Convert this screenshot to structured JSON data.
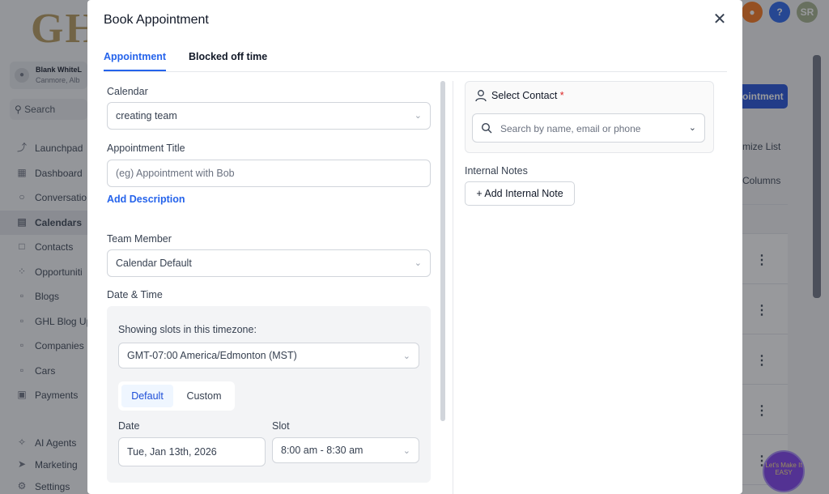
{
  "background": {
    "logo": "GH",
    "account": {
      "name": "Blank WhiteL",
      "location": "Canmore, Alb"
    },
    "search_label": "Search",
    "nav": [
      {
        "label": "Launchpad",
        "icon": "rocket-icon"
      },
      {
        "label": "Dashboard",
        "icon": "grid-icon"
      },
      {
        "label": "Conversatio",
        "icon": "chat-icon"
      },
      {
        "label": "Calendars",
        "icon": "calendar-icon",
        "active": true
      },
      {
        "label": "Contacts",
        "icon": "contacts-icon"
      },
      {
        "label": "Opportuniti",
        "icon": "opportunities-icon"
      },
      {
        "label": "Blogs",
        "icon": "blog-icon"
      },
      {
        "label": "GHL Blog Up",
        "icon": "blog-icon"
      },
      {
        "label": "Companies",
        "icon": "building-icon"
      },
      {
        "label": "Cars",
        "icon": "car-icon"
      },
      {
        "label": "Payments",
        "icon": "payments-icon"
      }
    ],
    "nav_bottom": [
      {
        "label": "AI Agents",
        "icon": "sparkle-icon"
      },
      {
        "label": "Marketing",
        "icon": "send-icon"
      },
      {
        "label": "Settings",
        "icon": "gear-icon"
      }
    ],
    "top_right": {
      "help": "?",
      "user_initials": "SR"
    },
    "new_appointment_label": "ointment",
    "customize_list_label": "mize List",
    "columns_label": "Columns",
    "badge_text": "Let's Make It EASY"
  },
  "modal": {
    "title": "Book Appointment",
    "tabs": [
      {
        "label": "Appointment",
        "active": true
      },
      {
        "label": "Blocked off time",
        "active": false
      }
    ],
    "calendar": {
      "label": "Calendar",
      "value": "creating team"
    },
    "appointment_title": {
      "label": "Appointment Title",
      "placeholder": "(eg) Appointment with Bob"
    },
    "add_description": "Add Description",
    "team_member": {
      "label": "Team Member",
      "value": "Calendar Default"
    },
    "date_time": {
      "label": "Date & Time",
      "timezone_label": "Showing slots in this timezone:",
      "timezone_value": "GMT-07:00 America/Edmonton (MST)",
      "mode_options": [
        "Default",
        "Custom"
      ],
      "mode_selected": "Default",
      "date_label": "Date",
      "date_value": "Tue, Jan 13th, 2026",
      "slot_label": "Slot",
      "slot_value": "8:00 am - 8:30 am"
    },
    "contact": {
      "label": "Select Contact",
      "required_mark": "*",
      "search_placeholder": "Search by name, email or phone"
    },
    "internal_notes": {
      "label": "Internal Notes",
      "add_label": "+ Add Internal Note"
    }
  },
  "colors": {
    "accent": "#2563eb",
    "required": "#dc2626",
    "logo": "#b7995a"
  }
}
